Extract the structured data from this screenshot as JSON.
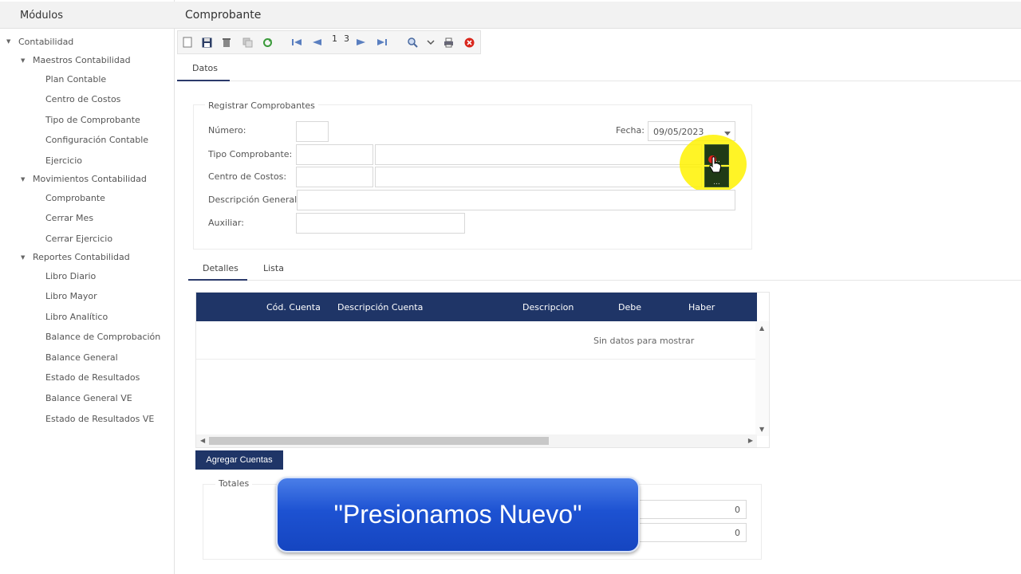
{
  "sidebar": {
    "title": "Módulos",
    "items": [
      {
        "label": "Contabilidad"
      },
      {
        "label": "Maestros Contabilidad"
      },
      {
        "label": "Plan Contable"
      },
      {
        "label": "Centro de Costos"
      },
      {
        "label": "Tipo de Comprobante"
      },
      {
        "label": "Configuración Contable"
      },
      {
        "label": "Ejercicio"
      },
      {
        "label": "Movimientos Contabilidad"
      },
      {
        "label": "Comprobante"
      },
      {
        "label": "Cerrar Mes"
      },
      {
        "label": "Cerrar Ejercicio"
      },
      {
        "label": "Reportes Contabilidad"
      },
      {
        "label": "Libro Diario"
      },
      {
        "label": "Libro Mayor"
      },
      {
        "label": "Libro Analítico"
      },
      {
        "label": "Balance de Comprobación"
      },
      {
        "label": "Balance General"
      },
      {
        "label": "Estado de Resultados"
      },
      {
        "label": "Balance General VE"
      },
      {
        "label": "Estado de Resultados VE"
      }
    ]
  },
  "header": {
    "title": "Comprobante"
  },
  "toolbar": {
    "page_current": "1",
    "page_total": "3"
  },
  "tabs": {
    "datos": "Datos",
    "detalles": "Detalles",
    "lista": "Lista"
  },
  "form": {
    "panel_title": "Registrar Comprobantes",
    "numero_label": "Número:",
    "fecha_label": "Fecha:",
    "fecha_value": "09/05/2023",
    "tipo_label": "Tipo Comprobante:",
    "centro_label": "Centro de Costos:",
    "descripcion_label": "Descripción General:",
    "auxiliar_label": "Auxiliar:",
    "lookup_label": "..."
  },
  "grid": {
    "columns": [
      "Cód. Cuenta",
      "Descripción Cuenta",
      "Descripcion",
      "Debe",
      "Haber"
    ],
    "empty_text": "Sin datos para mostrar"
  },
  "actions": {
    "add_accounts": "Agregar Cuentas"
  },
  "totals": {
    "title": "Totales",
    "values": [
      "0",
      "0"
    ]
  },
  "caption": {
    "text": "\"Presionamos Nuevo\""
  },
  "colors": {
    "header_navy": "#1f3567",
    "highlight": "#fff200",
    "caption_blue": "#1d52d2"
  }
}
